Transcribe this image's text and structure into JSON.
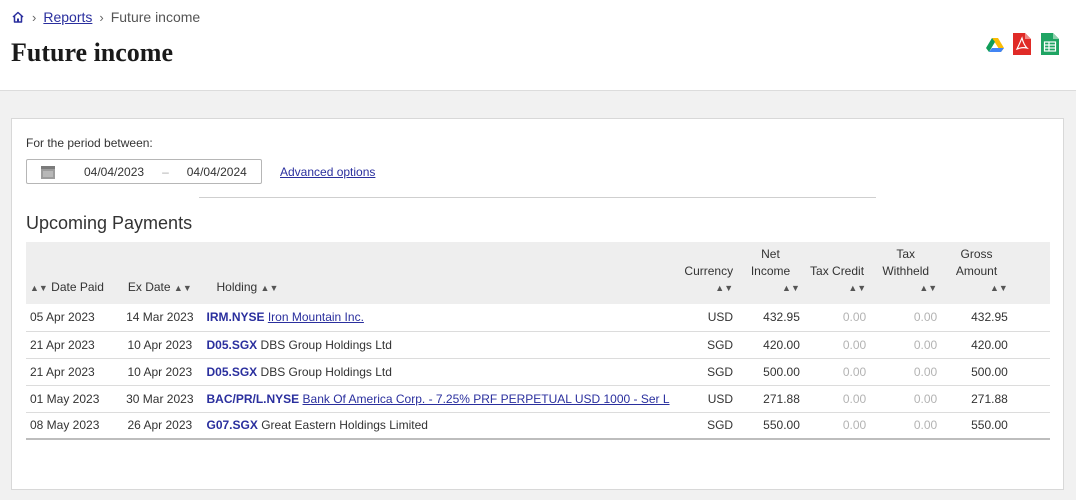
{
  "breadcrumb": {
    "home_icon": "home-icon",
    "reports": "Reports",
    "current": "Future income"
  },
  "page_title": "Future income",
  "exports": [
    "google-drive-icon",
    "pdf-icon",
    "spreadsheet-icon"
  ],
  "filters": {
    "period_label": "For the period between:",
    "start_date": "04/04/2023",
    "end_date": "04/04/2024",
    "dash": "–",
    "advanced_options": "Advanced options"
  },
  "section_title": "Upcoming Payments",
  "table": {
    "headers": {
      "date_paid": "Date Paid",
      "ex_date": "Ex Date",
      "holding": "Holding",
      "currency": "Currency",
      "net_income_1": "Net",
      "net_income_2": "Income",
      "tax_credit": "Tax Credit",
      "tax_withheld_1": "Tax",
      "tax_withheld_2": "Withheld",
      "gross_amount_1": "Gross",
      "gross_amount_2": "Amount"
    },
    "rows": [
      {
        "date_paid": "05 Apr 2023",
        "ex_date": "14 Mar 2023",
        "symbol": "IRM.NYSE",
        "name": "Iron Mountain Inc.",
        "linked": true,
        "currency": "USD",
        "net_income": "432.95",
        "tax_credit": "0.00",
        "tax_withheld": "0.00",
        "gross_amount": "432.95"
      },
      {
        "date_paid": "21 Apr 2023",
        "ex_date": "10 Apr 2023",
        "symbol": "D05.SGX",
        "name": "DBS Group Holdings Ltd",
        "linked": false,
        "currency": "SGD",
        "net_income": "420.00",
        "tax_credit": "0.00",
        "tax_withheld": "0.00",
        "gross_amount": "420.00"
      },
      {
        "date_paid": "21 Apr 2023",
        "ex_date": "10 Apr 2023",
        "symbol": "D05.SGX",
        "name": "DBS Group Holdings Ltd",
        "linked": false,
        "currency": "SGD",
        "net_income": "500.00",
        "tax_credit": "0.00",
        "tax_withheld": "0.00",
        "gross_amount": "500.00"
      },
      {
        "date_paid": "01 May 2023",
        "ex_date": "30 Mar 2023",
        "symbol": "BAC/PR/L.NYSE",
        "name": "Bank Of America Corp. - 7.25% PRF PERPETUAL USD 1000 - Ser L",
        "linked": true,
        "currency": "USD",
        "net_income": "271.88",
        "tax_credit": "0.00",
        "tax_withheld": "0.00",
        "gross_amount": "271.88"
      },
      {
        "date_paid": "08 May 2023",
        "ex_date": "26 Apr 2023",
        "symbol": "G07.SGX",
        "name": "Great Eastern Holdings Limited",
        "linked": false,
        "currency": "SGD",
        "net_income": "550.00",
        "tax_credit": "0.00",
        "tax_withheld": "0.00",
        "gross_amount": "550.00"
      }
    ]
  },
  "colors": {
    "link": "#2a2f9e",
    "muted": "#b3b3b3",
    "header_bg": "#eeeeee"
  }
}
